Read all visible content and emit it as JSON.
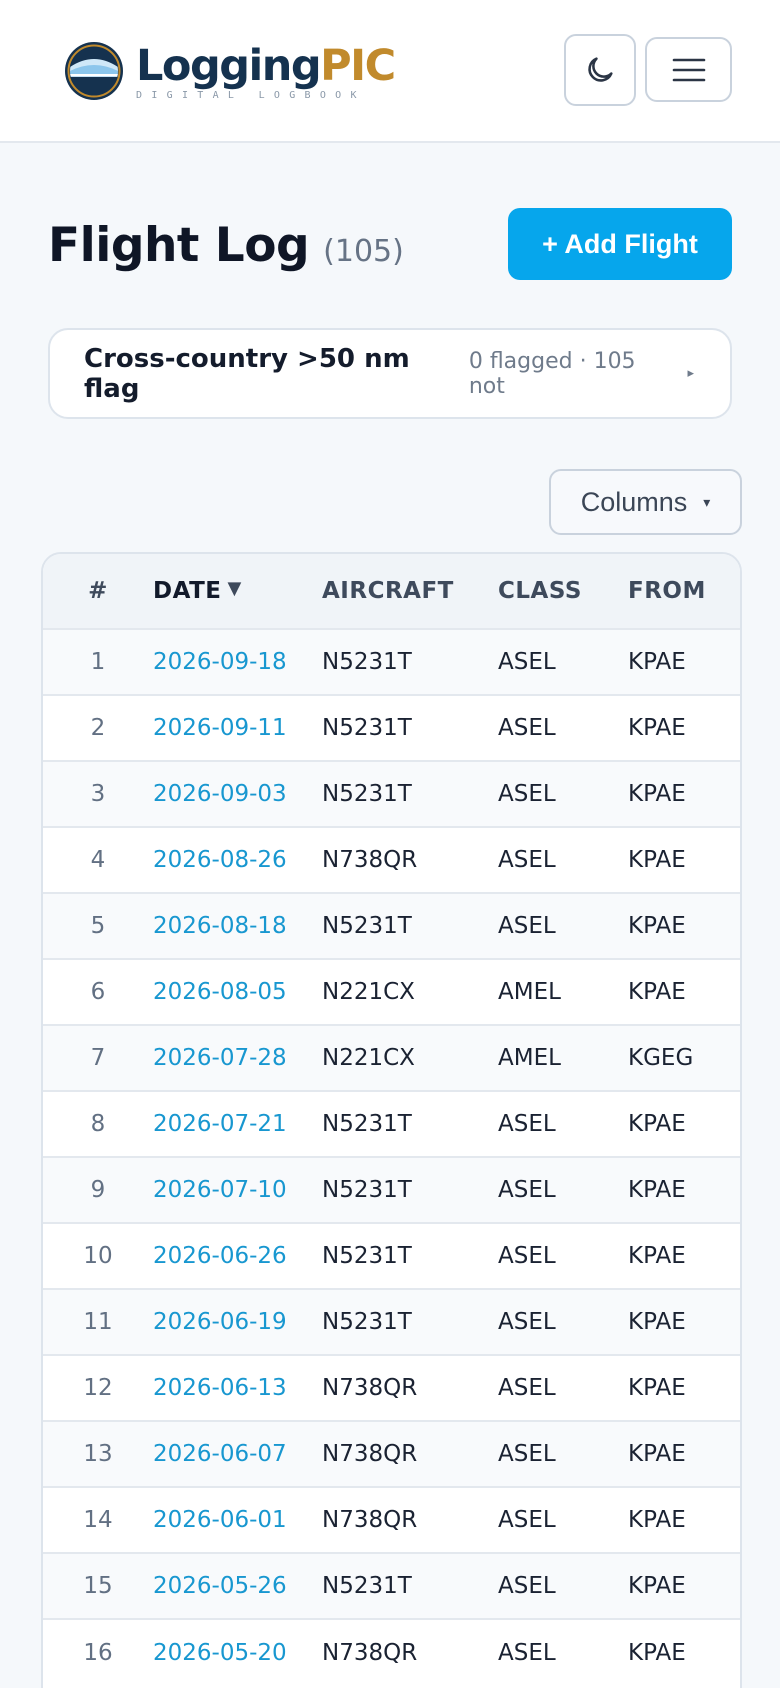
{
  "brand": {
    "name_part1": "Logging",
    "name_part2": "PIC",
    "tagline": "DIGITAL LOGBOOK",
    "colors": {
      "navy": "#15324f",
      "gold": "#c18a2c"
    }
  },
  "header": {
    "theme_toggle_icon": "moon-icon",
    "menu_icon": "hamburger-menu-icon"
  },
  "page": {
    "title": "Flight Log",
    "count": "(105)",
    "add_button": "+ Add Flight",
    "accent_color": "#06a6ec"
  },
  "flag_card": {
    "title": "Cross-country >50 nm flag",
    "summary": "0 flagged · 105 not",
    "caret": "▸"
  },
  "columns_button": {
    "label": "Columns",
    "caret": "▾"
  },
  "table": {
    "headers": {
      "num": "#",
      "date": "DATE",
      "date_sort": "▼",
      "aircraft": "AIRCRAFT",
      "class": "CLASS",
      "from": "FROM"
    },
    "rows": [
      {
        "num": "1",
        "date": "2026-09-18",
        "aircraft": "N5231T",
        "class": "ASEL",
        "from": "KPAE"
      },
      {
        "num": "2",
        "date": "2026-09-11",
        "aircraft": "N5231T",
        "class": "ASEL",
        "from": "KPAE"
      },
      {
        "num": "3",
        "date": "2026-09-03",
        "aircraft": "N5231T",
        "class": "ASEL",
        "from": "KPAE"
      },
      {
        "num": "4",
        "date": "2026-08-26",
        "aircraft": "N738QR",
        "class": "ASEL",
        "from": "KPAE"
      },
      {
        "num": "5",
        "date": "2026-08-18",
        "aircraft": "N5231T",
        "class": "ASEL",
        "from": "KPAE"
      },
      {
        "num": "6",
        "date": "2026-08-05",
        "aircraft": "N221CX",
        "class": "AMEL",
        "from": "KPAE"
      },
      {
        "num": "7",
        "date": "2026-07-28",
        "aircraft": "N221CX",
        "class": "AMEL",
        "from": "KGEG"
      },
      {
        "num": "8",
        "date": "2026-07-21",
        "aircraft": "N5231T",
        "class": "ASEL",
        "from": "KPAE"
      },
      {
        "num": "9",
        "date": "2026-07-10",
        "aircraft": "N5231T",
        "class": "ASEL",
        "from": "KPAE"
      },
      {
        "num": "10",
        "date": "2026-06-26",
        "aircraft": "N5231T",
        "class": "ASEL",
        "from": "KPAE"
      },
      {
        "num": "11",
        "date": "2026-06-19",
        "aircraft": "N5231T",
        "class": "ASEL",
        "from": "KPAE"
      },
      {
        "num": "12",
        "date": "2026-06-13",
        "aircraft": "N738QR",
        "class": "ASEL",
        "from": "KPAE"
      },
      {
        "num": "13",
        "date": "2026-06-07",
        "aircraft": "N738QR",
        "class": "ASEL",
        "from": "KPAE"
      },
      {
        "num": "14",
        "date": "2026-06-01",
        "aircraft": "N738QR",
        "class": "ASEL",
        "from": "KPAE"
      },
      {
        "num": "15",
        "date": "2026-05-26",
        "aircraft": "N5231T",
        "class": "ASEL",
        "from": "KPAE"
      },
      {
        "num": "16",
        "date": "2026-05-20",
        "aircraft": "N738QR",
        "class": "ASEL",
        "from": "KPAE"
      }
    ]
  }
}
